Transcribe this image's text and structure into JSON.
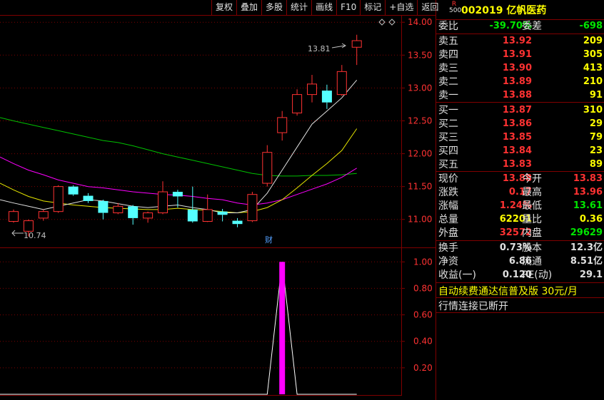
{
  "toolbar": [
    "复权",
    "叠加",
    "多股",
    "统计",
    "画线",
    "F10",
    "标记",
    "+自选",
    "返回"
  ],
  "stock": {
    "code": "002019",
    "name": "亿帆医药",
    "badge_top": "R",
    "badge_bottom": "500"
  },
  "colors": {
    "up": "#ff3232",
    "down": "#54ffff",
    "ma_white": "#e0e0e0",
    "ma_yellow": "#e6e600",
    "ma_magenta": "#ff00ff",
    "ma_green": "#00c000",
    "grid": "#800000"
  },
  "quote": {
    "weibi": {
      "label": "委比",
      "value": "-39.70%",
      "label2": "委差",
      "value2": "-698"
    },
    "asks": [
      {
        "label": "卖五",
        "price": "13.92",
        "vol": "209"
      },
      {
        "label": "卖四",
        "price": "13.91",
        "vol": "305"
      },
      {
        "label": "卖三",
        "price": "13.90",
        "vol": "413"
      },
      {
        "label": "卖二",
        "price": "13.89",
        "vol": "210"
      },
      {
        "label": "卖一",
        "price": "13.88",
        "vol": "91"
      }
    ],
    "bids": [
      {
        "label": "买一",
        "price": "13.87",
        "vol": "310"
      },
      {
        "label": "买二",
        "price": "13.86",
        "vol": "29"
      },
      {
        "label": "买三",
        "price": "13.85",
        "vol": "79"
      },
      {
        "label": "买四",
        "price": "13.84",
        "vol": "23"
      },
      {
        "label": "买五",
        "price": "13.83",
        "vol": "89"
      }
    ],
    "stats1": [
      {
        "l1": "现价",
        "v1": "13.88",
        "c1": "red",
        "l2": "今开",
        "v2": "13.83",
        "c2": "red"
      },
      {
        "l1": "涨跌",
        "v1": "0.17",
        "c1": "red",
        "l2": "最高",
        "v2": "13.96",
        "c2": "red"
      },
      {
        "l1": "涨幅",
        "v1": "1.24%",
        "c1": "red",
        "l2": "最低",
        "v2": "13.61",
        "c2": "green"
      },
      {
        "l1": "总量",
        "v1": "62201",
        "c1": "yellow",
        "l2": "量比",
        "v2": "0.36",
        "c2": "yellow"
      },
      {
        "l1": "外盘",
        "v1": "32572",
        "c1": "red",
        "l2": "内盘",
        "v2": "29629",
        "c2": "green"
      }
    ],
    "stats2": [
      {
        "l1": "换手",
        "v1": "0.73%",
        "l2": "股本",
        "v2": "12.3亿"
      },
      {
        "l1": "净资",
        "v1": "6.86",
        "l2": "流通",
        "v2": "8.51亿"
      },
      {
        "l1": "收益(一)",
        "v1": "0.120",
        "l2": "PE(动)",
        "v2": "29.1"
      }
    ],
    "promo": "自动续费通达信普及版  30元/月",
    "status": "行情连接已断开"
  },
  "main_chart": {
    "price_axis": [
      "14.00",
      "13.50",
      "13.00",
      "12.50",
      "12.00",
      "11.50",
      "11.00"
    ],
    "high_label": "13.81",
    "low_label": "10.74",
    "fin_marker": "财"
  },
  "chart_data": {
    "type": "candlestick",
    "ylim": [
      10.65,
      14.1
    ],
    "candles": [
      {
        "o": 10.97,
        "c": 11.12,
        "h": 11.15,
        "l": 10.95
      },
      {
        "o": 10.82,
        "c": 10.98,
        "h": 11.0,
        "l": 10.74
      },
      {
        "o": 11.02,
        "c": 11.12,
        "h": 11.15,
        "l": 10.98
      },
      {
        "o": 11.12,
        "c": 11.5,
        "h": 11.52,
        "l": 11.1
      },
      {
        "o": 11.5,
        "c": 11.38,
        "h": 11.52,
        "l": 11.36
      },
      {
        "o": 11.36,
        "c": 11.28,
        "h": 11.4,
        "l": 11.25
      },
      {
        "o": 11.28,
        "c": 11.1,
        "h": 11.3,
        "l": 11.0
      },
      {
        "o": 11.1,
        "c": 11.2,
        "h": 11.25,
        "l": 11.08
      },
      {
        "o": 11.2,
        "c": 11.02,
        "h": 11.22,
        "l": 10.92
      },
      {
        "o": 11.02,
        "c": 11.1,
        "h": 11.12,
        "l": 10.95
      },
      {
        "o": 11.1,
        "c": 11.42,
        "h": 11.58,
        "l": 11.08
      },
      {
        "o": 11.42,
        "c": 11.35,
        "h": 11.45,
        "l": 11.18
      },
      {
        "o": 11.15,
        "c": 10.97,
        "h": 11.5,
        "l": 10.95
      },
      {
        "o": 10.97,
        "c": 11.15,
        "h": 11.38,
        "l": 10.96
      },
      {
        "o": 11.12,
        "c": 11.07,
        "h": 11.16,
        "l": 10.97
      },
      {
        "o": 10.98,
        "c": 10.93,
        "h": 11.02,
        "l": 10.88
      },
      {
        "o": 10.98,
        "c": 11.38,
        "h": 11.42,
        "l": 10.96
      },
      {
        "o": 11.55,
        "c": 12.02,
        "h": 12.13,
        "l": 11.5
      },
      {
        "o": 12.32,
        "c": 12.55,
        "h": 12.65,
        "l": 12.2
      },
      {
        "o": 12.62,
        "c": 12.9,
        "h": 12.98,
        "l": 12.58
      },
      {
        "o": 12.9,
        "c": 13.06,
        "h": 13.2,
        "l": 12.78
      },
      {
        "o": 12.96,
        "c": 12.78,
        "h": 13.05,
        "l": 12.68
      },
      {
        "o": 12.9,
        "c": 13.25,
        "h": 13.35,
        "l": 12.88
      },
      {
        "o": 13.62,
        "c": 13.72,
        "h": 13.81,
        "l": 13.35
      }
    ],
    "ma_white": [
      11.25,
      11.2,
      11.15,
      11.2,
      11.25,
      11.3,
      11.28,
      11.24,
      11.2,
      11.18,
      11.2,
      11.22,
      11.18,
      11.15,
      11.1,
      11.1,
      11.15,
      11.4,
      11.75,
      12.1,
      12.45,
      12.65,
      12.85,
      13.12
    ],
    "ma_yellow": [
      11.45,
      11.35,
      11.28,
      11.25,
      11.22,
      11.2,
      11.18,
      11.17,
      11.16,
      11.15,
      11.15,
      11.17,
      11.15,
      11.14,
      11.12,
      11.1,
      11.12,
      11.18,
      11.3,
      11.48,
      11.67,
      11.85,
      12.05,
      12.38
    ],
    "ma_magenta": [
      11.85,
      11.75,
      11.68,
      11.6,
      11.55,
      11.5,
      11.48,
      11.45,
      11.42,
      11.4,
      11.38,
      11.37,
      11.35,
      11.32,
      11.3,
      11.25,
      11.22,
      11.25,
      11.3,
      11.38,
      11.46,
      11.54,
      11.64,
      11.78
    ],
    "ma_green": [
      12.5,
      12.45,
      12.4,
      12.35,
      12.3,
      12.25,
      12.2,
      12.17,
      12.12,
      12.06,
      12.0,
      11.95,
      11.9,
      11.85,
      11.8,
      11.75,
      11.7,
      11.67,
      11.66,
      11.66,
      11.67,
      11.67,
      11.68,
      11.7
    ],
    "sub_axis": [
      "1.00",
      "0.80",
      "0.60",
      "0.40",
      "0.20"
    ],
    "sub_ylim": [
      0,
      1.05
    ],
    "sub_values": [
      0,
      0,
      0,
      0,
      0,
      0,
      0,
      0,
      0,
      0,
      0,
      0,
      0,
      0,
      0,
      0,
      0,
      0,
      1,
      0,
      0,
      0,
      0,
      0
    ]
  }
}
